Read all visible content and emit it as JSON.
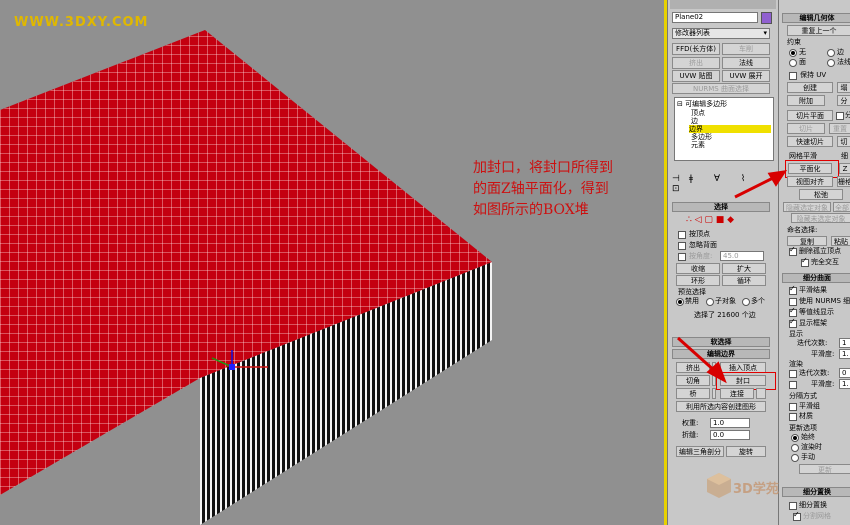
{
  "watermark": "WWW.3DXY.COM",
  "annotation": {
    "lines": [
      "加封口，将封口所得到",
      "的面Z轴平面化，得到",
      "如图所示的BOX堆"
    ]
  },
  "colors": {
    "mesh": "#c40010",
    "highlight": "#f0e000",
    "annotation": "#cc1010",
    "arrow": "#d80000"
  },
  "modify_panel": {
    "object_name": "Plane02",
    "modifier_list": "修改器列表",
    "buttons": {
      "ffd": "FFD(长方体)",
      "lathe": "车削",
      "extrude": "挤出",
      "normal": "法线",
      "uvw_map": "UVW 贴图",
      "uvw_unwrap": "UVW 展开",
      "smooth": "NURMS 曲面选择"
    },
    "stack": {
      "root": "可编辑多边形",
      "items": [
        "顶点",
        "边",
        "边界",
        "多边形",
        "元素"
      ],
      "selected": "边界"
    },
    "selection": {
      "title": "选择",
      "by_vertex": "按顶点",
      "ignore_backface": "忽略背面",
      "by_angle": "按角度:",
      "angle_value": "45.0",
      "shrink": "收缩",
      "grow": "扩大",
      "ring": "环形",
      "loop": "循环",
      "preview_title": "预览选择",
      "preview_off": "禁用",
      "preview_sub": "子对象",
      "preview_multi": "多个",
      "status": "选择了 21600 个边"
    },
    "soft_selection": "软选择",
    "edit_borders": {
      "title": "编辑边界",
      "extrude": "挤出",
      "insert_vertex": "插入顶点",
      "chamfer": "切角",
      "cap": "封口",
      "bridge": "桥",
      "connect": "连接",
      "create_shape": "利用所选内容创建图形",
      "weight_label": "权重:",
      "weight_value": "1.0",
      "crease_label": "折缝:",
      "crease_value": "0.0",
      "edit_tri": "编辑三角剖分",
      "turn": "旋转"
    }
  },
  "geometry_panel": {
    "title": "编辑几何体",
    "repeat": "重复上一个",
    "constraints": "约束",
    "none": "无",
    "edge": "边",
    "face": "面",
    "normal": "法线",
    "preserve_uv": "保持 UV",
    "create": "创建",
    "collapse": "塌",
    "attach": "附加",
    "detach": "分",
    "slice_plane": "切片平面",
    "split": "分",
    "slice": "切片",
    "reset_plane": "重置",
    "quickslice": "快速切片",
    "cut": "切",
    "meshsmooth": "网格平滑",
    "tessellate": "细",
    "planarize": "平面化",
    "axis_z": "Z",
    "view_align": "视图对齐",
    "grid_align": "栅格",
    "relax": "松弛",
    "hide_sel": "隐藏选定对象",
    "unhide_all": "全部",
    "hide_unsel": "隐藏未选定对象",
    "named_sel": "命名选择:",
    "copy": "复制",
    "paste": "粘贴",
    "delete_iso": "删除孤立顶点",
    "full_interact": "完全交互",
    "subdiv_title": "细分曲面",
    "smooth_result": "平滑结果",
    "use_nurms": "使用 NURMS 细分",
    "isoline": "等值线显示",
    "show_cage": "显示框架",
    "display": "显示",
    "iterations": "迭代次数:",
    "iter_val": "1",
    "smoothness": "平滑度:",
    "smooth_val": "1.",
    "render": "渲染",
    "r_iterations": "迭代次数:",
    "r_iter_val": "0",
    "r_smoothness": "平滑度:",
    "r_smooth_val": "1.",
    "sep": "分隔方式",
    "smoothing_groups": "平滑组",
    "materials": "材质",
    "update": "更新选项",
    "always": "始终",
    "when_render": "渲染时",
    "manual": "手动",
    "update_btn": "更新",
    "subdiv_disp": "细分置换",
    "subdiv_disp_chk": "细分置换",
    "split_mesh": "分割网格",
    "logo": "3D学苑"
  }
}
